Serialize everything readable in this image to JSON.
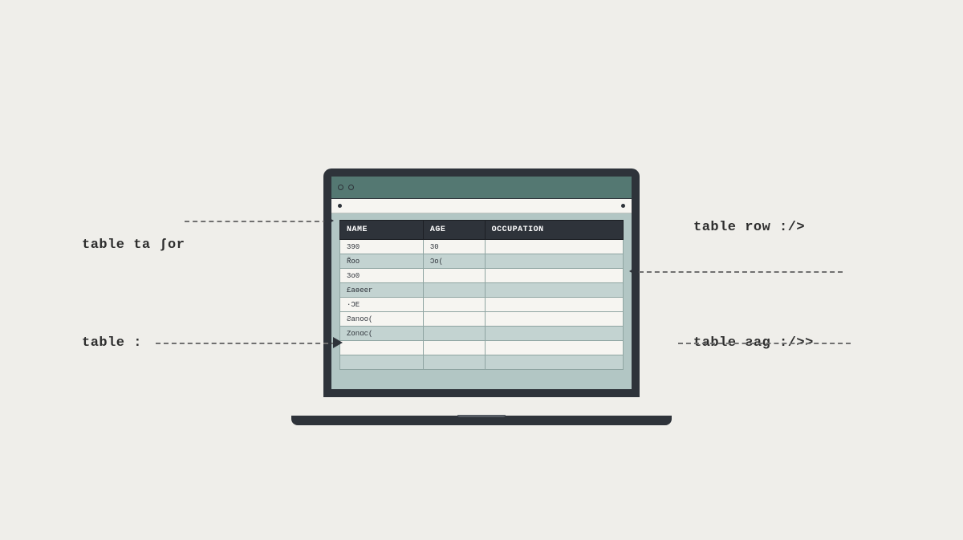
{
  "annotations": {
    "left1": "table ta ʃor",
    "left2": "table :",
    "right1": "table row :/>",
    "right2": "table ƨag :/>>"
  },
  "table": {
    "headers": [
      "NAME",
      "AGE",
      "OCCUPATION"
    ],
    "rows": [
      {
        "c0": "390",
        "c1": "30",
        "c2": "",
        "shaded": false
      },
      {
        "c0": "R̃oo",
        "c1": "Ɔo(",
        "c2": "",
        "shaded": true
      },
      {
        "c0": "3o0",
        "c1": "",
        "c2": "",
        "shaded": false
      },
      {
        "c0": "£aɵeer",
        "c1": "",
        "c2": "",
        "shaded": true
      },
      {
        "c0": "·ƆE",
        "c1": "",
        "c2": "",
        "shaded": false
      },
      {
        "c0": "Ƨanoo(",
        "c1": "",
        "c2": "",
        "shaded": false
      },
      {
        "c0": "Zonɑc(",
        "c1": "",
        "c2": "",
        "shaded": true
      },
      {
        "c0": "",
        "c1": "",
        "c2": "",
        "shaded": false
      },
      {
        "c0": "",
        "c1": "",
        "c2": "",
        "shaded": true
      }
    ]
  },
  "colors": {
    "bg": "#efeeea",
    "frame": "#2e333a",
    "titlebar": "#547872",
    "cellShade": "#c3d3d1",
    "cell": "#f6f5f1",
    "tableBg": "#b2c6c4"
  }
}
